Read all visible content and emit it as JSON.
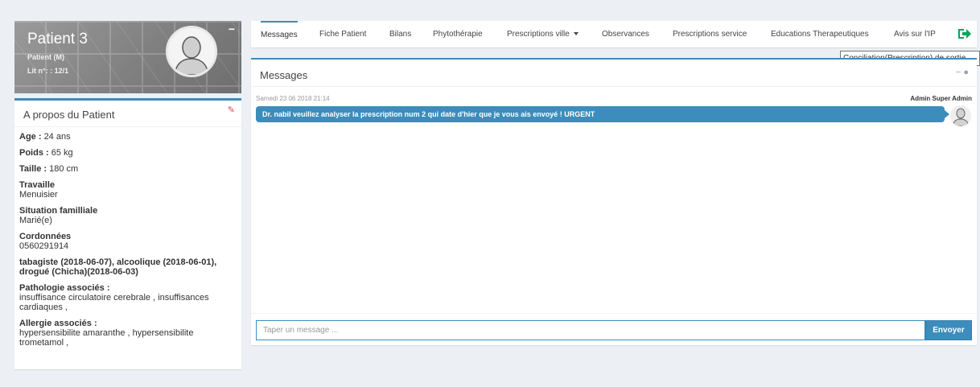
{
  "patient": {
    "name": "Patient 3",
    "sub": "Patient (M)",
    "bed": "Lit n°: : 12/1",
    "collapse": "−"
  },
  "about": {
    "title": "A propos du Patient",
    "age_label": "Age :",
    "age": "24 ans",
    "weight_label": "Poids :",
    "weight": "65 kg",
    "height_label": "Taille :",
    "height": "180 cm",
    "job_label": "Travaille",
    "job": "Menuisier",
    "family_label": "Situation familliale",
    "family": "Marié(e)",
    "contact_label": "Cordonnées",
    "contact": "0560291914",
    "habits": "tabagiste (2018-06-07), alcoolique (2018-06-01), drogué (Chicha)(2018-06-03)",
    "pathology_label": "Pathologie associés :",
    "pathology": "insuffisance circulatoire cerebrale , insuffisances cardiaques ,",
    "allergy_label": "Allergie associés :",
    "allergy": "hypersensibilite amaranthe , hypersensibilite trometamol ,"
  },
  "tabs": [
    {
      "label": "Messages"
    },
    {
      "label": "Fiche Patient"
    },
    {
      "label": "Bilans"
    },
    {
      "label": "Phytothérapie"
    },
    {
      "label": "Prescriptions ville"
    },
    {
      "label": "Observances"
    },
    {
      "label": "Prescriptions service"
    },
    {
      "label": "Educations Therapeutiques"
    },
    {
      "label": "Avis sur l'IP"
    }
  ],
  "tooltip": "Conciliation(Prescription) de sortie",
  "messages": {
    "title": "Messages",
    "tools": "−  ●",
    "time": "Samedi 23 06 2018 21:14",
    "author": "Admin Super Admin",
    "text": "Dr. nabil veuillez analyser la prescription num 2 qui date d'hier que je vous ais envoyé ! URGENT",
    "input_placeholder": "Taper un message ...",
    "send_label": "Envoyer"
  },
  "colors": {
    "accent": "#3c8dbc",
    "logout": "#00a65a",
    "edit": "#dd4b39"
  }
}
